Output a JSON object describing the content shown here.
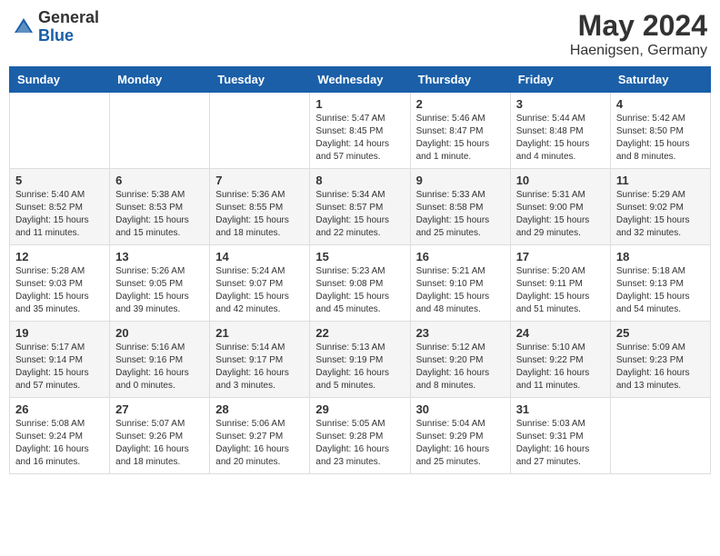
{
  "header": {
    "logo_general": "General",
    "logo_blue": "Blue",
    "title": "May 2024",
    "location": "Haenigsen, Germany"
  },
  "weekdays": [
    "Sunday",
    "Monday",
    "Tuesday",
    "Wednesday",
    "Thursday",
    "Friday",
    "Saturday"
  ],
  "weeks": [
    [
      {
        "day": "",
        "info": ""
      },
      {
        "day": "",
        "info": ""
      },
      {
        "day": "",
        "info": ""
      },
      {
        "day": "1",
        "info": "Sunrise: 5:47 AM\nSunset: 8:45 PM\nDaylight: 14 hours\nand 57 minutes."
      },
      {
        "day": "2",
        "info": "Sunrise: 5:46 AM\nSunset: 8:47 PM\nDaylight: 15 hours\nand 1 minute."
      },
      {
        "day": "3",
        "info": "Sunrise: 5:44 AM\nSunset: 8:48 PM\nDaylight: 15 hours\nand 4 minutes."
      },
      {
        "day": "4",
        "info": "Sunrise: 5:42 AM\nSunset: 8:50 PM\nDaylight: 15 hours\nand 8 minutes."
      }
    ],
    [
      {
        "day": "5",
        "info": "Sunrise: 5:40 AM\nSunset: 8:52 PM\nDaylight: 15 hours\nand 11 minutes."
      },
      {
        "day": "6",
        "info": "Sunrise: 5:38 AM\nSunset: 8:53 PM\nDaylight: 15 hours\nand 15 minutes."
      },
      {
        "day": "7",
        "info": "Sunrise: 5:36 AM\nSunset: 8:55 PM\nDaylight: 15 hours\nand 18 minutes."
      },
      {
        "day": "8",
        "info": "Sunrise: 5:34 AM\nSunset: 8:57 PM\nDaylight: 15 hours\nand 22 minutes."
      },
      {
        "day": "9",
        "info": "Sunrise: 5:33 AM\nSunset: 8:58 PM\nDaylight: 15 hours\nand 25 minutes."
      },
      {
        "day": "10",
        "info": "Sunrise: 5:31 AM\nSunset: 9:00 PM\nDaylight: 15 hours\nand 29 minutes."
      },
      {
        "day": "11",
        "info": "Sunrise: 5:29 AM\nSunset: 9:02 PM\nDaylight: 15 hours\nand 32 minutes."
      }
    ],
    [
      {
        "day": "12",
        "info": "Sunrise: 5:28 AM\nSunset: 9:03 PM\nDaylight: 15 hours\nand 35 minutes."
      },
      {
        "day": "13",
        "info": "Sunrise: 5:26 AM\nSunset: 9:05 PM\nDaylight: 15 hours\nand 39 minutes."
      },
      {
        "day": "14",
        "info": "Sunrise: 5:24 AM\nSunset: 9:07 PM\nDaylight: 15 hours\nand 42 minutes."
      },
      {
        "day": "15",
        "info": "Sunrise: 5:23 AM\nSunset: 9:08 PM\nDaylight: 15 hours\nand 45 minutes."
      },
      {
        "day": "16",
        "info": "Sunrise: 5:21 AM\nSunset: 9:10 PM\nDaylight: 15 hours\nand 48 minutes."
      },
      {
        "day": "17",
        "info": "Sunrise: 5:20 AM\nSunset: 9:11 PM\nDaylight: 15 hours\nand 51 minutes."
      },
      {
        "day": "18",
        "info": "Sunrise: 5:18 AM\nSunset: 9:13 PM\nDaylight: 15 hours\nand 54 minutes."
      }
    ],
    [
      {
        "day": "19",
        "info": "Sunrise: 5:17 AM\nSunset: 9:14 PM\nDaylight: 15 hours\nand 57 minutes."
      },
      {
        "day": "20",
        "info": "Sunrise: 5:16 AM\nSunset: 9:16 PM\nDaylight: 16 hours\nand 0 minutes."
      },
      {
        "day": "21",
        "info": "Sunrise: 5:14 AM\nSunset: 9:17 PM\nDaylight: 16 hours\nand 3 minutes."
      },
      {
        "day": "22",
        "info": "Sunrise: 5:13 AM\nSunset: 9:19 PM\nDaylight: 16 hours\nand 5 minutes."
      },
      {
        "day": "23",
        "info": "Sunrise: 5:12 AM\nSunset: 9:20 PM\nDaylight: 16 hours\nand 8 minutes."
      },
      {
        "day": "24",
        "info": "Sunrise: 5:10 AM\nSunset: 9:22 PM\nDaylight: 16 hours\nand 11 minutes."
      },
      {
        "day": "25",
        "info": "Sunrise: 5:09 AM\nSunset: 9:23 PM\nDaylight: 16 hours\nand 13 minutes."
      }
    ],
    [
      {
        "day": "26",
        "info": "Sunrise: 5:08 AM\nSunset: 9:24 PM\nDaylight: 16 hours\nand 16 minutes."
      },
      {
        "day": "27",
        "info": "Sunrise: 5:07 AM\nSunset: 9:26 PM\nDaylight: 16 hours\nand 18 minutes."
      },
      {
        "day": "28",
        "info": "Sunrise: 5:06 AM\nSunset: 9:27 PM\nDaylight: 16 hours\nand 20 minutes."
      },
      {
        "day": "29",
        "info": "Sunrise: 5:05 AM\nSunset: 9:28 PM\nDaylight: 16 hours\nand 23 minutes."
      },
      {
        "day": "30",
        "info": "Sunrise: 5:04 AM\nSunset: 9:29 PM\nDaylight: 16 hours\nand 25 minutes."
      },
      {
        "day": "31",
        "info": "Sunrise: 5:03 AM\nSunset: 9:31 PM\nDaylight: 16 hours\nand 27 minutes."
      },
      {
        "day": "",
        "info": ""
      }
    ]
  ]
}
